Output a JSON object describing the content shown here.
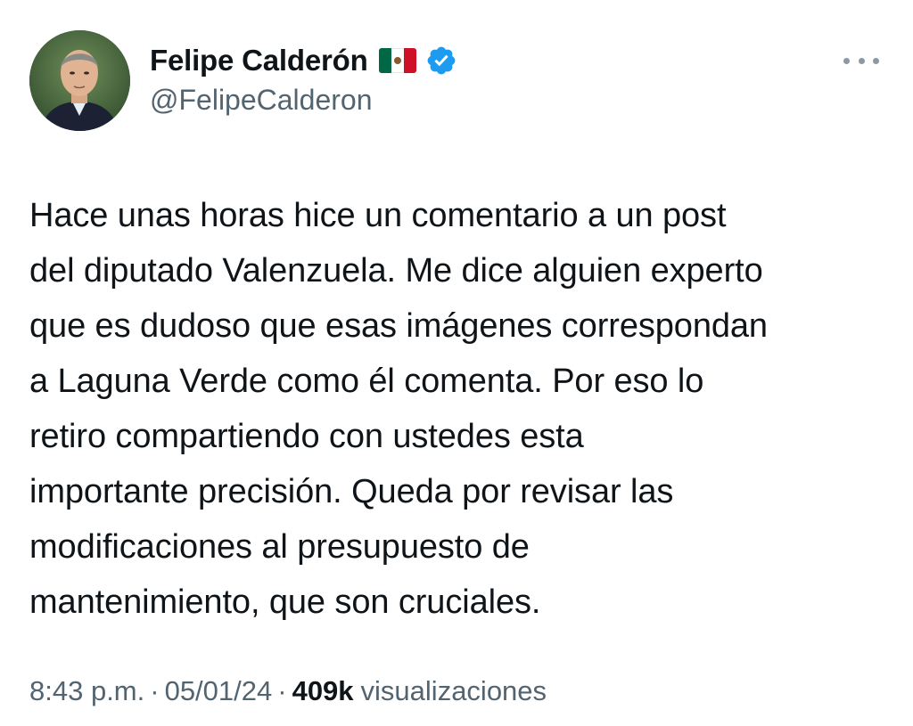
{
  "tweet": {
    "author": {
      "display_name": "Felipe Calderón",
      "handle": "@FelipeCalderon",
      "flag_icon": "mexico-flag-icon",
      "verified_icon": "verified-badge-icon",
      "verified_color": "#1d9bf0"
    },
    "more_icon": "more-options-icon",
    "text": "Hace unas horas hice un comentario a un post\ndel diputado Valenzuela. Me dice alguien experto\nque es dudoso que esas imágenes correspondan\na Laguna Verde como él comenta. Por eso lo\nretiro  compartiendo con ustedes esta\nimportante precisión. Queda por revisar las\nmodificaciones al presupuesto de\nmantenimiento, que son cruciales.",
    "meta": {
      "time": "8:43 p.m.",
      "separator": "·",
      "date": "05/01/24",
      "views_count": "409k",
      "views_label": "visualizaciones"
    }
  }
}
